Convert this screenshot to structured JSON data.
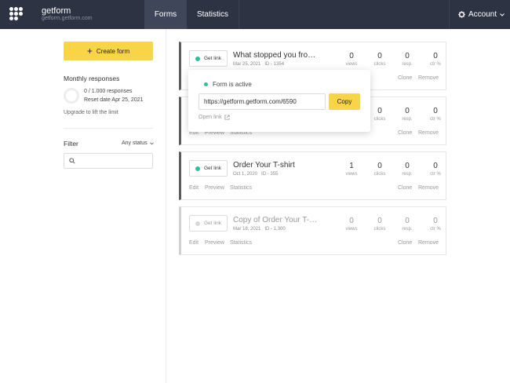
{
  "brand": {
    "name": "getform",
    "url": "getform.getform.com"
  },
  "nav": {
    "forms": "Forms",
    "statistics": "Statistics",
    "account": "Account"
  },
  "sidebar": {
    "create_label": "Create form",
    "monthly_title": "Monthly responses",
    "responses_used": "0 / 1.000 responses",
    "reset_date": "Reset date Apr 25, 2021",
    "upgrade": "Upgrade to lift the limit",
    "filter_label": "Filter",
    "status_select": "Any status",
    "search_placeholder": ""
  },
  "card_labels": {
    "get_link": "Get link",
    "views": "views",
    "clicks": "clicks",
    "resp": "resp.",
    "ctr": "ctr %",
    "edit": "Edit",
    "preview": "Preview",
    "statistics": "Statistics",
    "clone": "Clone",
    "remove": "Remove"
  },
  "forms": [
    {
      "title": "What stopped you from purchasing?",
      "date": "Mar 25, 2021",
      "id": "ID - 1354",
      "views": "0",
      "clicks": "0",
      "resp": "0",
      "ctr": "0",
      "active": true
    },
    {
      "title": "",
      "date": "",
      "id": "",
      "views": "0",
      "clicks": "0",
      "resp": "0",
      "ctr": "0",
      "active": true
    },
    {
      "title": "Order Your T-shirt",
      "date": "Oct 1, 2020",
      "id": "ID - 355",
      "views": "1",
      "clicks": "0",
      "resp": "0",
      "ctr": "0",
      "active": true
    },
    {
      "title": "Copy of Order Your T-shirt",
      "date": "Mar 18, 2021",
      "id": "ID - 1,300",
      "views": "0",
      "clicks": "0",
      "resp": "0",
      "ctr": "0",
      "active": false
    }
  ],
  "popover": {
    "status": "Form is active",
    "url": "https://getform.getform.com/6590",
    "copy": "Copy",
    "open_link": "Open link"
  },
  "colors": {
    "topbar": "#2e3344",
    "accent": "#f8d447",
    "active_dot": "#2fbfa0"
  }
}
